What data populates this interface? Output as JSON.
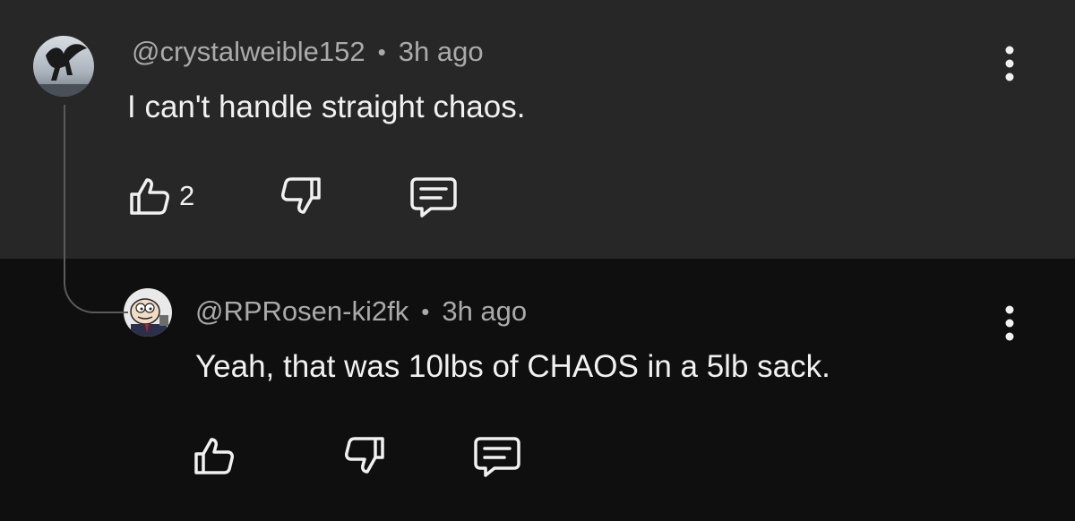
{
  "comments": [
    {
      "author": "@crystalweible152",
      "separator": "•",
      "time": "3h ago",
      "text": "I can't handle straight chaos.",
      "like_count": "2",
      "icons": {
        "avatar": "pegasus-avatar",
        "like": "thumbs-up-icon",
        "dislike": "thumbs-down-icon",
        "reply": "reply-icon",
        "more": "more-vert-icon"
      }
    },
    {
      "author": "@RPRosen-ki2fk",
      "separator": "•",
      "time": "3h ago",
      "text": "Yeah, that was 10lbs of CHAOS in a 5lb sack.",
      "like_count": "",
      "icons": {
        "avatar": "cartoon-character-avatar",
        "like": "thumbs-up-icon",
        "dislike": "thumbs-down-icon",
        "reply": "reply-icon",
        "more": "more-vert-icon"
      }
    }
  ],
  "colors": {
    "top_background": "#272727",
    "reply_background": "#0f0f0f",
    "primary_text": "#f1f1f1",
    "secondary_text": "#aaaaaa",
    "thread_line": "#5a5a5a"
  }
}
